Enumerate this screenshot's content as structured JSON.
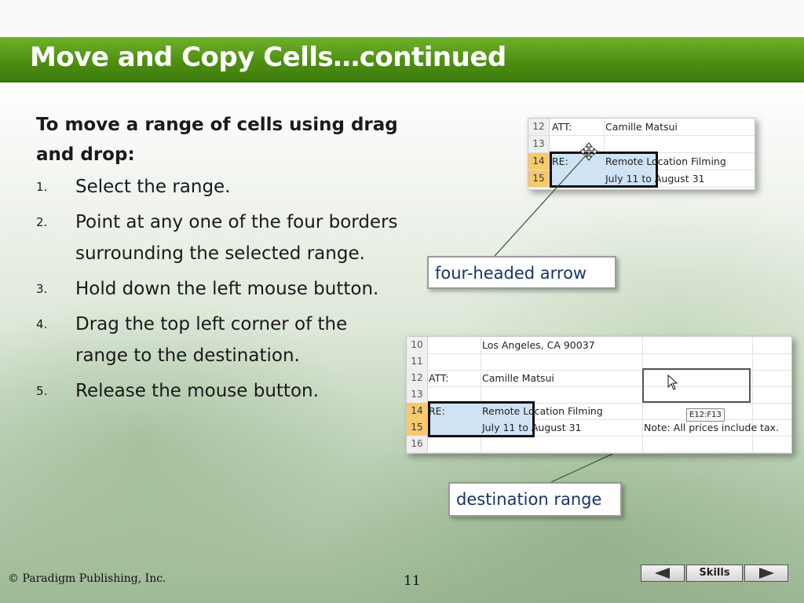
{
  "slide": {
    "title": "Move and Copy Cells…continued",
    "heading": "To move a range of cells using drag and drop:",
    "steps": [
      {
        "num": "1.",
        "text": "Select the range."
      },
      {
        "num": "2.",
        "text": "Point at any one of the four borders surrounding the selected range."
      },
      {
        "num": "3.",
        "text": "Hold down the left mouse button."
      },
      {
        "num": "4.",
        "text": "Drag the top left corner of the range to the destination."
      },
      {
        "num": "5.",
        "text": "Release the mouse button."
      }
    ]
  },
  "screenshot1": {
    "rows": [
      {
        "num": "12",
        "a": "ATT:",
        "b": "Camille Matsui"
      },
      {
        "num": "13",
        "a": "",
        "b": ""
      },
      {
        "num": "14",
        "a": "RE:",
        "b": "Remote Location Filming"
      },
      {
        "num": "15",
        "a": "",
        "b": "July 11 to August 31"
      }
    ],
    "callout": "four-headed arrow"
  },
  "screenshot2": {
    "rows": [
      {
        "num": "10",
        "a": "",
        "b": "Los Angeles, CA 90037",
        "note": ""
      },
      {
        "num": "11",
        "a": "",
        "b": "",
        "note": ""
      },
      {
        "num": "12",
        "a": "ATT:",
        "b": "Camille Matsui",
        "note": ""
      },
      {
        "num": "13",
        "a": "",
        "b": "",
        "note": ""
      },
      {
        "num": "14",
        "a": "RE:",
        "b": "Remote Location Filming",
        "note": ""
      },
      {
        "num": "15",
        "a": "",
        "b": "July 11 to August 31",
        "note": "Note: All prices include tax."
      },
      {
        "num": "16",
        "a": "",
        "b": "",
        "note": ""
      }
    ],
    "tooltip": "E12:F13",
    "callout": "destination range"
  },
  "footer": {
    "copyright": "© Paradigm Publishing, Inc.",
    "page_number": "11",
    "skills_label": "Skills"
  },
  "colors": {
    "title_bar": "#4e8f12",
    "selection_fill": "#cfe3f5",
    "row_header_selected": "#f7c96a",
    "callout_text": "#15356a"
  }
}
